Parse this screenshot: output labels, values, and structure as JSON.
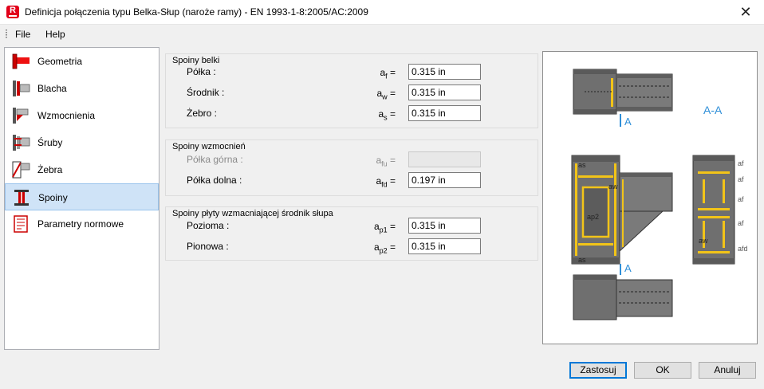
{
  "window": {
    "title": "Definicja połączenia typu Belka-Słup (naroże ramy) - EN 1993-1-8:2005/AC:2009",
    "app_icon_letter": "R",
    "close_glyph": "✕"
  },
  "menu": {
    "file": "File",
    "help": "Help"
  },
  "sidebar": {
    "items": [
      {
        "label": "Geometria",
        "icon": "geometry-icon"
      },
      {
        "label": "Blacha",
        "icon": "plate-icon"
      },
      {
        "label": "Wzmocnienia",
        "icon": "stiffeners-icon"
      },
      {
        "label": "Śruby",
        "icon": "bolts-icon"
      },
      {
        "label": "Żebra",
        "icon": "ribs-icon"
      },
      {
        "label": "Spoiny",
        "icon": "welds-icon",
        "selected": true
      },
      {
        "label": "Parametry normowe",
        "icon": "code-parameters-icon"
      }
    ]
  },
  "beam_welds": {
    "title": "Spoiny belki",
    "rows": [
      {
        "label": "Półka :",
        "sym": "a",
        "sub": "f",
        "value": "0.315 in"
      },
      {
        "label": "Środnik :",
        "sym": "a",
        "sub": "w",
        "value": "0.315 in"
      },
      {
        "label": "Żebro :",
        "sym": "a",
        "sub": "s",
        "value": "0.315 in"
      }
    ]
  },
  "stiffener_welds": {
    "title": "Spoiny wzmocnień",
    "rows": [
      {
        "label": "Półka górna :",
        "sym": "a",
        "sub": "fu",
        "value": "",
        "disabled": true
      },
      {
        "label": "Półka dolna :",
        "sym": "a",
        "sub": "fd",
        "value": "0.197 in"
      }
    ]
  },
  "web_plate_welds": {
    "title": "Spoiny płyty wzmacniającej środnik słupa",
    "rows": [
      {
        "label": "Pozioma :",
        "sym": "a",
        "sub": "p1",
        "value": "0.315 in"
      },
      {
        "label": "Pionowa :",
        "sym": "a",
        "sub": "p2",
        "value": "0.315 in"
      }
    ]
  },
  "preview": {
    "section_label": "A-A",
    "cut_marker": "A",
    "labels": {
      "as": "as",
      "aw": "aw",
      "ap2": "ap2",
      "af": "af",
      "afd": "afd"
    },
    "colors": {
      "steel": "#6f6f6f",
      "weld": "#f2c418",
      "accent": "#2f8fd8"
    }
  },
  "buttons": {
    "apply": "Zastosuj",
    "ok": "OK",
    "cancel": "Anuluj"
  }
}
